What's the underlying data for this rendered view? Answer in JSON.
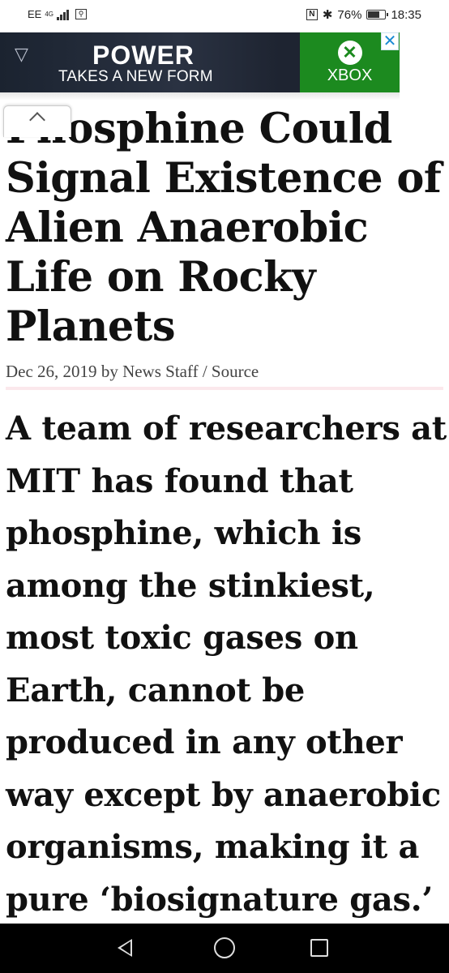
{
  "status_bar": {
    "carrier": "EE",
    "network": "4G",
    "battery_percent": "76%",
    "battery_level": 0.76,
    "time": "18:35"
  },
  "ad": {
    "headline": "POWER",
    "subline": "TAKES A NEW FORM",
    "brand": "XBOX",
    "close": "✕",
    "brand_color": "#1c8a1f"
  },
  "article": {
    "title": "Phosphine Could Signal Existence of Alien Anaerobic Life on Rocky Planets",
    "meta": {
      "date": "Dec 26, 2019",
      "by": "by",
      "author": "News Staff",
      "separator": "/",
      "source": "Source"
    },
    "lead": "A team of researchers at MIT has found that phosphine, which is among the stinkiest, most toxic gases on Earth, cannot be produced in any other way except by anaerobic organisms, making it a pure ‘biosignature gas.’"
  },
  "icons": {
    "collapse": "chevron-up-icon",
    "back": "back-icon",
    "home": "home-icon",
    "recents": "recents-icon"
  }
}
